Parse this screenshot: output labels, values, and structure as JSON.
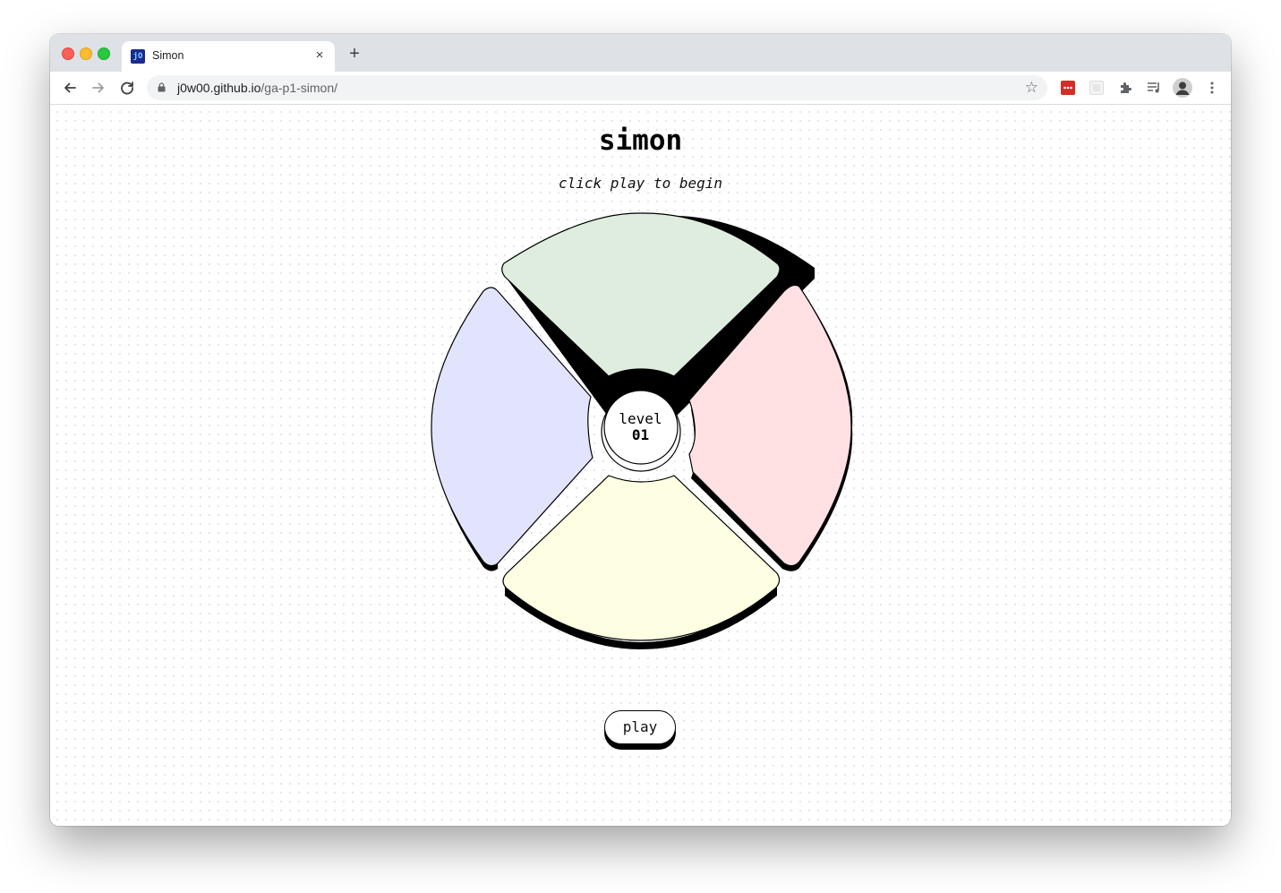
{
  "browser": {
    "tab_title": "Simon",
    "favicon_text": "jO",
    "new_tab_label": "+",
    "tab_close_label": "×",
    "url_host": "j0w00.github.io",
    "url_path": "/ga-p1-simon/",
    "icons": [
      "back-icon",
      "forward-icon",
      "reload-icon",
      "lock-icon",
      "star-icon",
      "lastpass-extension-icon",
      "extension-placeholder-icon",
      "puzzle-extensions-icon",
      "reading-list-icon",
      "profile-avatar-icon",
      "kebab-menu-icon"
    ]
  },
  "game": {
    "title": "simon",
    "subtitle": "click play to begin",
    "level_label": "level",
    "level_value": "01",
    "play_label": "play",
    "pads": [
      {
        "name": "green",
        "color": "#dfeddf"
      },
      {
        "name": "red",
        "color": "#ffe1e3"
      },
      {
        "name": "yellow",
        "color": "#fefee3"
      },
      {
        "name": "blue",
        "color": "#e2e4fe"
      }
    ]
  }
}
